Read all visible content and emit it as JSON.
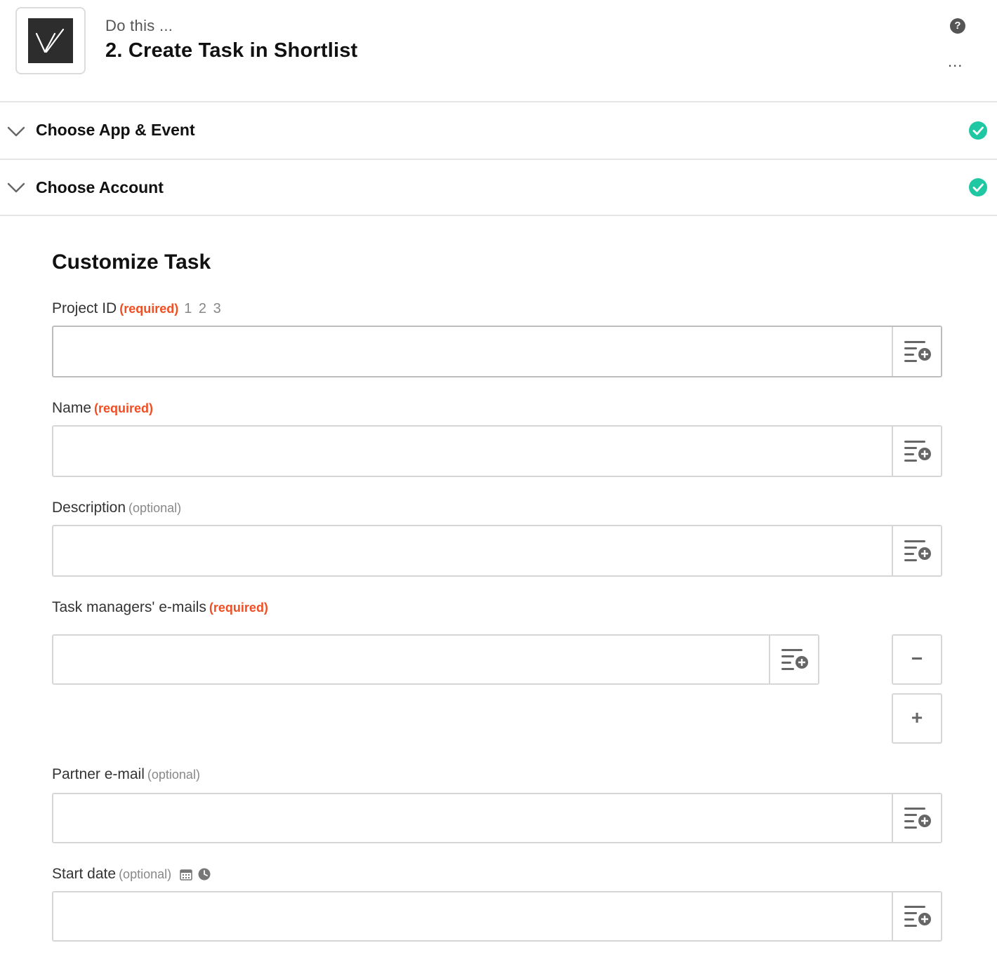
{
  "header": {
    "kicker": "Do this ...",
    "title": "2. Create Task in Shortlist",
    "app_icon": "shortlist-logo",
    "help_icon": "question-circle-icon",
    "more_icon": "ellipsis-icon",
    "more_label": "..."
  },
  "sections": [
    {
      "label": "Choose App & Event",
      "status": "complete",
      "icon": "check-circle-icon"
    },
    {
      "label": "Choose Account",
      "status": "complete",
      "icon": "check-circle-icon"
    }
  ],
  "form": {
    "title": "Customize Task",
    "fields": [
      {
        "label": "Project ID",
        "tag": "(required)",
        "extra": "1 2 3",
        "value": "",
        "button_icon": "insert-data-icon"
      },
      {
        "label": "Name",
        "tag": "(required)",
        "value": "",
        "button_icon": "insert-data-icon"
      },
      {
        "label": "Description",
        "tag": "(optional)",
        "value": "",
        "button_icon": "insert-data-icon"
      },
      {
        "label": "Task managers' e-mails",
        "tag": "(required)",
        "value": "",
        "button_icon": "insert-data-icon",
        "remove_label": "−",
        "add_label": "+"
      },
      {
        "label": "Partner e-mail",
        "tag": "(optional)",
        "value": "",
        "button_icon": "insert-data-icon"
      },
      {
        "label": "Start date",
        "tag": "(optional)",
        "value": "",
        "button_icon": "insert-data-icon",
        "hint_icons": [
          "calendar-icon",
          "clock-icon"
        ]
      }
    ]
  },
  "colors": {
    "required": "#f04e23",
    "success": "#1fc8a3",
    "border": "#d6d6d6"
  }
}
